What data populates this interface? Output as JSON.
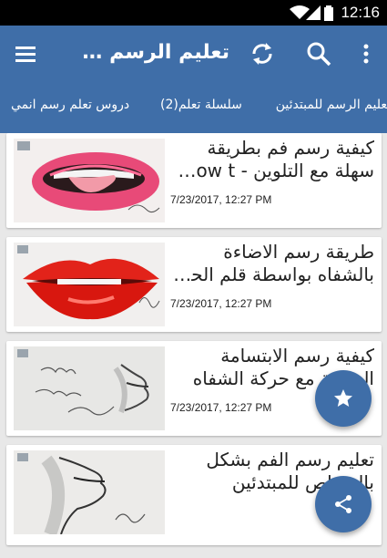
{
  "status_bar": {
    "time": "12:16",
    "icons": [
      "wifi-icon",
      "signal-icon",
      "battery-icon"
    ]
  },
  "app_bar": {
    "title": "تعليم الرسم خط...",
    "menu_icon": "hamburger-menu-icon",
    "actions": [
      "refresh-icon",
      "search-icon",
      "more-vert-icon"
    ],
    "color": "#3f6ea8"
  },
  "tabs": [
    "تعليم الرسم للمبتدئين",
    "سلسلة تعلم(2)",
    "دروس تعلم رسم انمي"
  ],
  "videos": [
    {
      "title_line1": "كيفية رسم فم بطريقة",
      "title_line2": "سهلة مع التلوين - How t...",
      "date": "7/23/2017, 12:27 PM"
    },
    {
      "title_line1": "طريقة رسم الاضاءة",
      "title_line2": "بالشفاه بواسطة قلم الحبر...",
      "date": "7/23/2017, 12:27 PM"
    },
    {
      "title_line1": "كيفية رسم الابتسامة",
      "title_line2": "الجانبية مع حركة الشفاه",
      "date": "7/23/2017, 12:27 PM"
    },
    {
      "title_line1": "تعليم رسم الفم بشكل",
      "title_line2": "بالرصاص للمبتدئين",
      "date": ""
    }
  ],
  "fabs": [
    "star-icon",
    "share-icon"
  ]
}
